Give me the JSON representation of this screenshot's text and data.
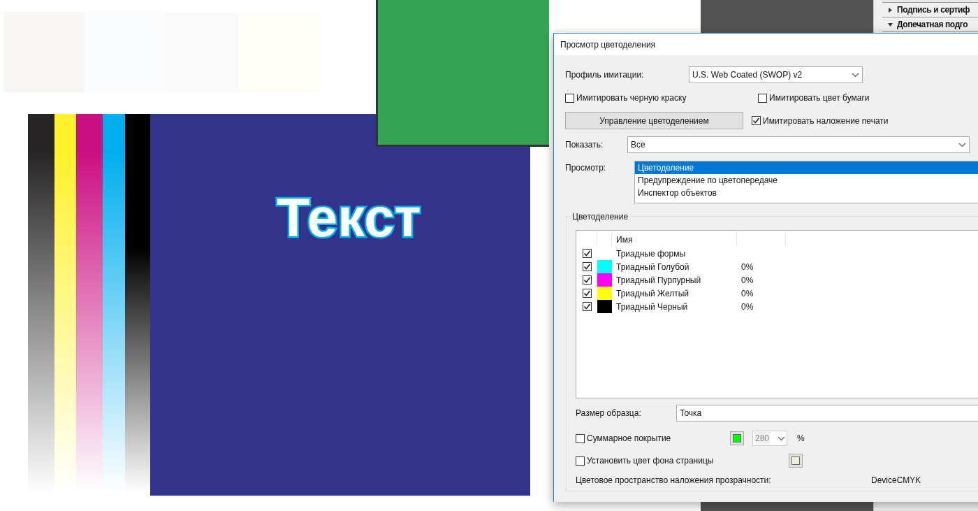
{
  "canvas": {
    "artwork_text": "Текст"
  },
  "side_panel": {
    "items": [
      {
        "label": "Подпись и сертиф",
        "expanded": false
      },
      {
        "label": "Допечатная подго",
        "expanded": true
      }
    ]
  },
  "dialog": {
    "title": "Просмотр цветоделения",
    "profile": {
      "label": "Профиль имитации:",
      "value": "U.S. Web Coated (SWOP) v2"
    },
    "simulate_black": {
      "label": "Имитировать черную краску",
      "checked": false
    },
    "simulate_paper": {
      "label": "Имитировать цвет бумаги",
      "checked": false
    },
    "manage_button": "Управление цветоделением",
    "simulate_overprint": {
      "label": "Имитировать наложение печати",
      "checked": true
    },
    "show": {
      "label": "Показать:",
      "value": "Все"
    },
    "preview": {
      "label": "Просмотр:",
      "items": [
        {
          "label": "Цветоделение",
          "selected": true
        },
        {
          "label": "Предупреждение по цветопередаче",
          "selected": false
        },
        {
          "label": "Инспектор объектов",
          "selected": false
        }
      ]
    },
    "separations": {
      "legend": "Цветоделение",
      "columns": [
        "Имя"
      ],
      "rows": [
        {
          "checked": true,
          "name": "Триадные формы"
        },
        {
          "checked": true,
          "color": "#00ffff",
          "name": "Триадный Голубой",
          "value": "0%"
        },
        {
          "checked": true,
          "color": "#ff00ff",
          "name": "Триадный Пурпурный",
          "value": "0%"
        },
        {
          "checked": true,
          "color": "#ffff00",
          "name": "Триадный Желтый",
          "value": "0%"
        },
        {
          "checked": true,
          "color": "#000000",
          "name": "Триадный Черный",
          "value": "0%"
        }
      ]
    },
    "sample_size": {
      "label": "Размер образца:",
      "value": "Точка"
    },
    "total_coverage": {
      "label": "Суммарное покрытие",
      "checked": false,
      "color": "#00ff00",
      "value": "280",
      "unit": "%"
    },
    "page_background": {
      "label": "Установить цвет фона страницы",
      "checked": false,
      "color": "#efefdc"
    },
    "blending_space": {
      "label": "Цветовое пространство наложения прозрачности:",
      "value": "DeviceCMYK"
    }
  }
}
